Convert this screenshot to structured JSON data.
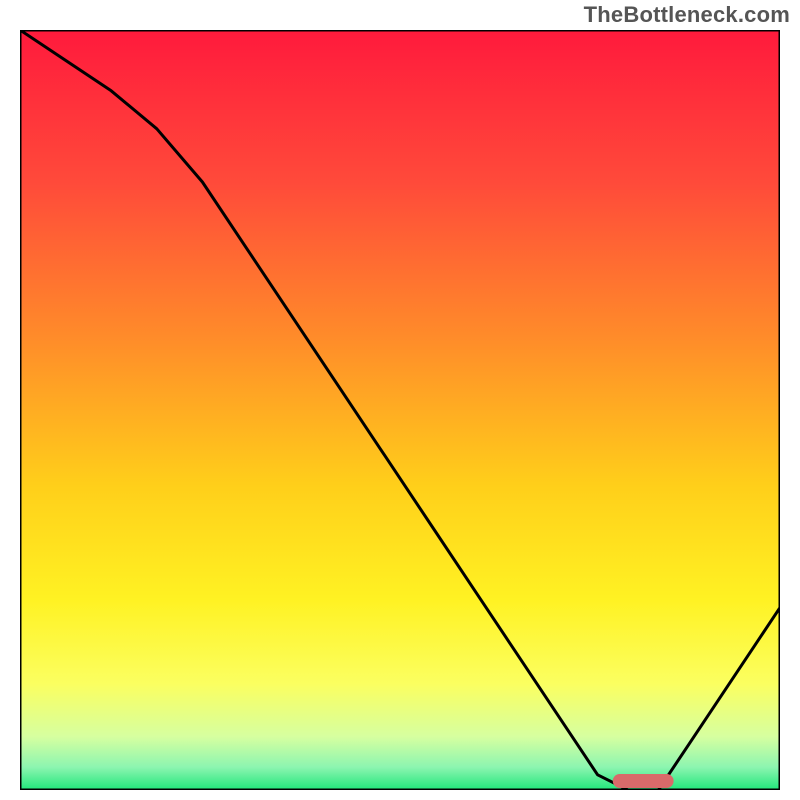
{
  "watermark": "TheBottleneck.com",
  "chart_data": {
    "type": "line",
    "title": "",
    "xlabel": "",
    "ylabel": "",
    "xlim": [
      0,
      100
    ],
    "ylim": [
      0,
      100
    ],
    "grid": false,
    "legend": false,
    "series": [
      {
        "name": "bottleneck-curve",
        "x": [
          0,
          6,
          12,
          18,
          24,
          30,
          36,
          42,
          48,
          54,
          60,
          66,
          72,
          76,
          80,
          84,
          88,
          92,
          96,
          100
        ],
        "values": [
          100,
          96,
          92,
          87,
          80,
          71,
          62,
          53,
          44,
          35,
          26,
          17,
          8,
          2,
          0,
          0,
          6,
          12,
          18,
          24
        ]
      }
    ],
    "marker": {
      "name": "optimal-range",
      "x_start": 78,
      "x_end": 86,
      "y": 0,
      "color": "#d96a6a"
    },
    "background_gradient": {
      "type": "vertical-linear",
      "stops": [
        {
          "offset": 0.0,
          "color": "#ff1a3c"
        },
        {
          "offset": 0.2,
          "color": "#ff4a3a"
        },
        {
          "offset": 0.4,
          "color": "#ff8a2a"
        },
        {
          "offset": 0.6,
          "color": "#ffcf1a"
        },
        {
          "offset": 0.75,
          "color": "#fff223"
        },
        {
          "offset": 0.86,
          "color": "#fbff60"
        },
        {
          "offset": 0.93,
          "color": "#d6ffa0"
        },
        {
          "offset": 0.97,
          "color": "#8cf5b0"
        },
        {
          "offset": 1.0,
          "color": "#20e67a"
        }
      ]
    }
  }
}
